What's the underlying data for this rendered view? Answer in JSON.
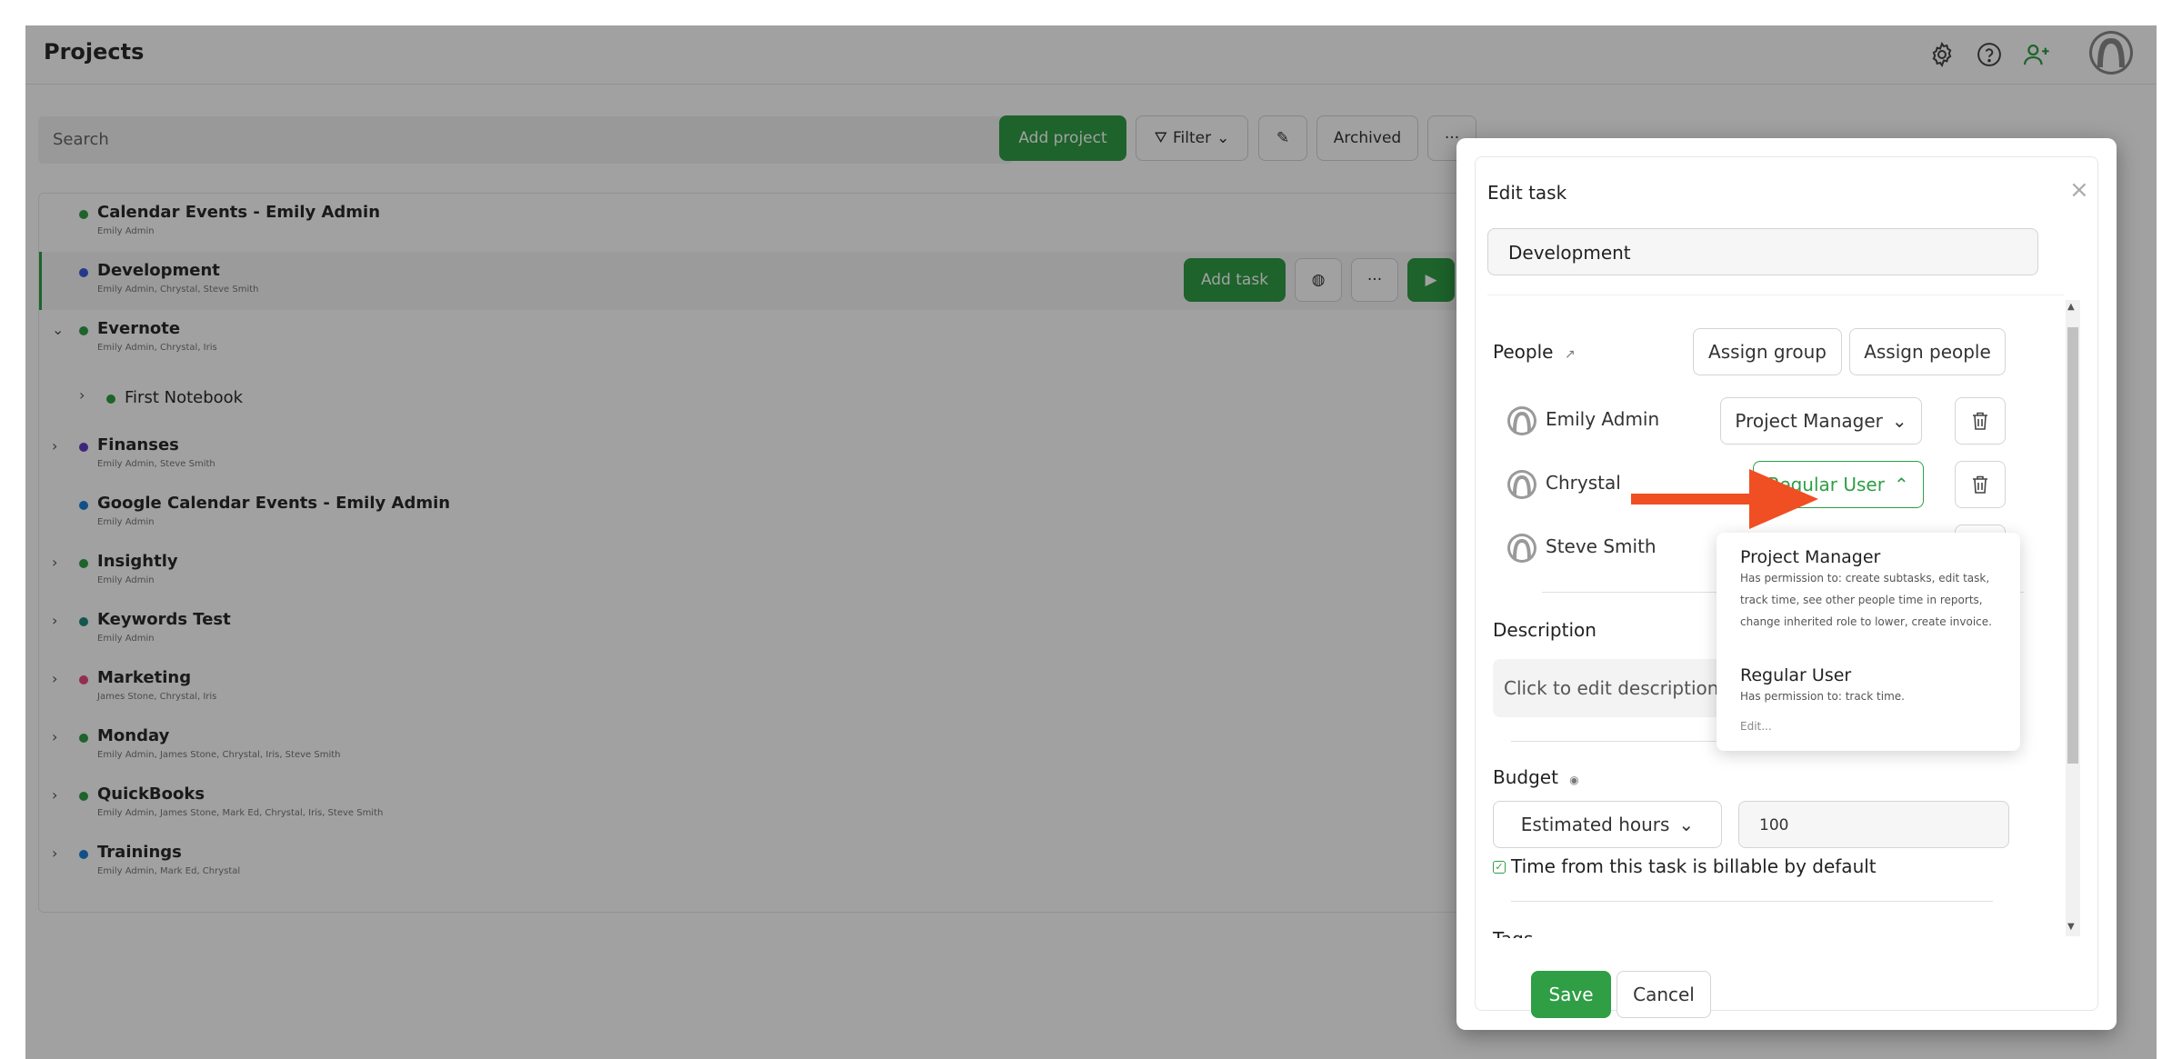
{
  "header": {
    "title": "Projects",
    "icons": [
      "gear-icon",
      "help-icon",
      "add-user-icon",
      "avatar-icon"
    ]
  },
  "toolbar": {
    "search_placeholder": "Search",
    "add_project": "Add project",
    "filter": "Filter",
    "archived": "Archived",
    "more": "···"
  },
  "row_actions": {
    "add_task": "Add task",
    "more": "···"
  },
  "projects": [
    {
      "name": "Calendar Events - Emily Admin",
      "people": "Emily Admin",
      "color": "#2f9e44",
      "chevron": ""
    },
    {
      "name": "Development",
      "people": "Emily Admin, Chrystal, Steve Smith",
      "color": "#3b5bdb",
      "chevron": ""
    },
    {
      "name": "Evernote",
      "people": "Emily Admin, Chrystal, Iris",
      "color": "#2f9e44",
      "chevron": "⌄"
    },
    {
      "name": "First Notebook",
      "people": "",
      "color": "#2f9e44",
      "chevron": "›"
    },
    {
      "name": "Finanses",
      "people": "Emily Admin, Steve Smith",
      "color": "#5f3dc4",
      "chevron": "›"
    },
    {
      "name": "Google Calendar Events - Emily Admin",
      "people": "Emily Admin",
      "color": "#1c7ed6",
      "chevron": ""
    },
    {
      "name": "Insightly",
      "people": "Emily Admin",
      "color": "#2f9e44",
      "chevron": "›"
    },
    {
      "name": "Keywords Test",
      "people": "Emily Admin",
      "color": "#20897a",
      "chevron": "›"
    },
    {
      "name": "Marketing",
      "people": "James Stone, Chrystal, Iris",
      "color": "#e64980",
      "chevron": "›"
    },
    {
      "name": "Monday",
      "people": "Emily Admin, James Stone, Chrystal, Iris, Steve Smith",
      "color": "#2f9e44",
      "chevron": "›"
    },
    {
      "name": "QuickBooks",
      "people": "Emily Admin, James Stone, Mark Ed, Chrystal, Iris, Steve Smith",
      "color": "#2f9e44",
      "chevron": "›"
    },
    {
      "name": "Trainings",
      "people": "Emily Admin, Mark Ed, Chrystal",
      "color": "#1c7ed6",
      "chevron": "›"
    }
  ],
  "dialog": {
    "title": "Edit task",
    "close": "×",
    "task_name": "Development",
    "people_label": "People",
    "assign_group": "Assign group",
    "assign_people": "Assign people",
    "people": [
      {
        "name": "Emily Admin",
        "role": "Project Manager"
      },
      {
        "name": "Chrystal",
        "role": "Regular User"
      },
      {
        "name": "Steve Smith",
        "role": ""
      }
    ],
    "description_label": "Description",
    "description_placeholder": "Click to edit description",
    "budget_label": "Budget",
    "budget_type": "Estimated hours",
    "budget_value": "100",
    "billable_label": "Time from this task is billable by default",
    "tags_label": "Tags",
    "save": "Save",
    "cancel": "Cancel"
  },
  "role_menu": {
    "options": [
      {
        "name": "Project Manager",
        "desc": "Has permission to: create subtasks, edit task, track time, see other people time in reports, change inherited role to lower, create invoice."
      },
      {
        "name": "Regular User",
        "desc": "Has permission to: track time."
      }
    ],
    "edit": "Edit..."
  },
  "colors": {
    "accent": "#2f9e44",
    "annotation_arrow": "#f04e23"
  }
}
